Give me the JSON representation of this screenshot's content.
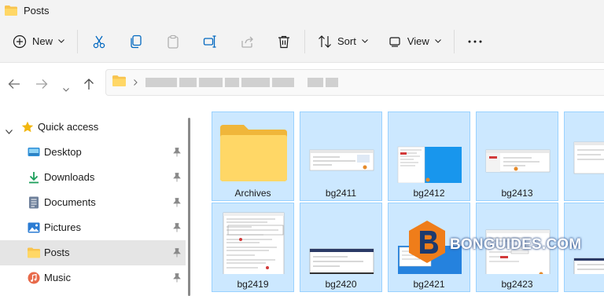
{
  "window": {
    "title": "Posts"
  },
  "toolbar": {
    "new_label": "New",
    "sort_label": "Sort",
    "view_label": "View",
    "icons": [
      "plus-circle-icon",
      "cut-icon",
      "copy-icon",
      "paste-icon",
      "rename-icon",
      "share-icon",
      "delete-icon",
      "sort-icon",
      "view-icon",
      "more-icon"
    ]
  },
  "sidebar": {
    "items": [
      {
        "label": "Quick access",
        "icon": "star-icon"
      },
      {
        "label": "Desktop",
        "icon": "desktop-icon",
        "pinned": true
      },
      {
        "label": "Downloads",
        "icon": "download-icon",
        "pinned": true
      },
      {
        "label": "Documents",
        "icon": "document-icon",
        "pinned": true
      },
      {
        "label": "Pictures",
        "icon": "pictures-icon",
        "pinned": true
      },
      {
        "label": "Posts",
        "icon": "folder-icon",
        "pinned": true,
        "selected": true
      },
      {
        "label": "Music",
        "icon": "music-icon",
        "pinned": true
      }
    ]
  },
  "files": [
    {
      "name": "Archives",
      "type": "folder"
    },
    {
      "name": "bg2411",
      "type": "image"
    },
    {
      "name": "bg2412",
      "type": "image"
    },
    {
      "name": "bg2413",
      "type": "image"
    },
    {
      "name": "",
      "type": "image"
    },
    {
      "name": "bg2419",
      "type": "image"
    },
    {
      "name": "bg2420",
      "type": "image"
    },
    {
      "name": "bg2421",
      "type": "image"
    },
    {
      "name": "bg2423",
      "type": "image"
    },
    {
      "name": "",
      "type": "image"
    }
  ],
  "watermark": {
    "text": "BONGUIDES.COM"
  },
  "colors": {
    "selection": "#cce8ff",
    "selection_border": "#99d1ff",
    "folder": "#f8c44f",
    "accent": "#0067c0"
  }
}
